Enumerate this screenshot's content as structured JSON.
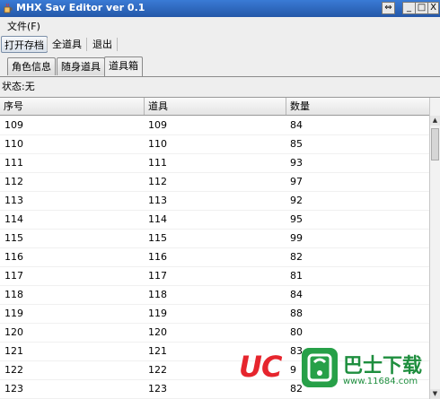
{
  "window": {
    "title": "MHX Sav Editor ver 0.1"
  },
  "window_controls": {
    "restore": "⇔",
    "minimize": "_",
    "maximize": "□",
    "close": "X"
  },
  "menu": {
    "file": "文件(F)"
  },
  "toolbar": {
    "open": "打开存档",
    "all_items": "全道具",
    "exit": "退出"
  },
  "tabs": [
    {
      "label": "角色信息"
    },
    {
      "label": "随身道具"
    },
    {
      "label": "道具箱"
    }
  ],
  "selected_tab": "道具箱",
  "status": "状态:无",
  "table": {
    "columns": [
      "序号",
      "道具",
      "数量"
    ],
    "rows": [
      [
        "109",
        "109",
        "84"
      ],
      [
        "110",
        "110",
        "85"
      ],
      [
        "111",
        "111",
        "93"
      ],
      [
        "112",
        "112",
        "97"
      ],
      [
        "113",
        "113",
        "92"
      ],
      [
        "114",
        "114",
        "95"
      ],
      [
        "115",
        "115",
        "99"
      ],
      [
        "116",
        "116",
        "82"
      ],
      [
        "117",
        "117",
        "81"
      ],
      [
        "118",
        "118",
        "84"
      ],
      [
        "119",
        "119",
        "88"
      ],
      [
        "120",
        "120",
        "80"
      ],
      [
        "121",
        "121",
        "83"
      ],
      [
        "122",
        "122",
        "9"
      ],
      [
        "123",
        "123",
        "82"
      ]
    ]
  },
  "watermark": {
    "logo": "UC",
    "name": "巴士下载",
    "url": "www.11684.com"
  },
  "colors": {
    "titlebar": "#2f6bc4",
    "watermark_red": "#e6252d",
    "watermark_green": "#1e8e3e"
  },
  "icons": {
    "app": "java-cup-icon",
    "scroll_up": "arrow-up-icon",
    "scroll_down": "arrow-down-icon"
  }
}
